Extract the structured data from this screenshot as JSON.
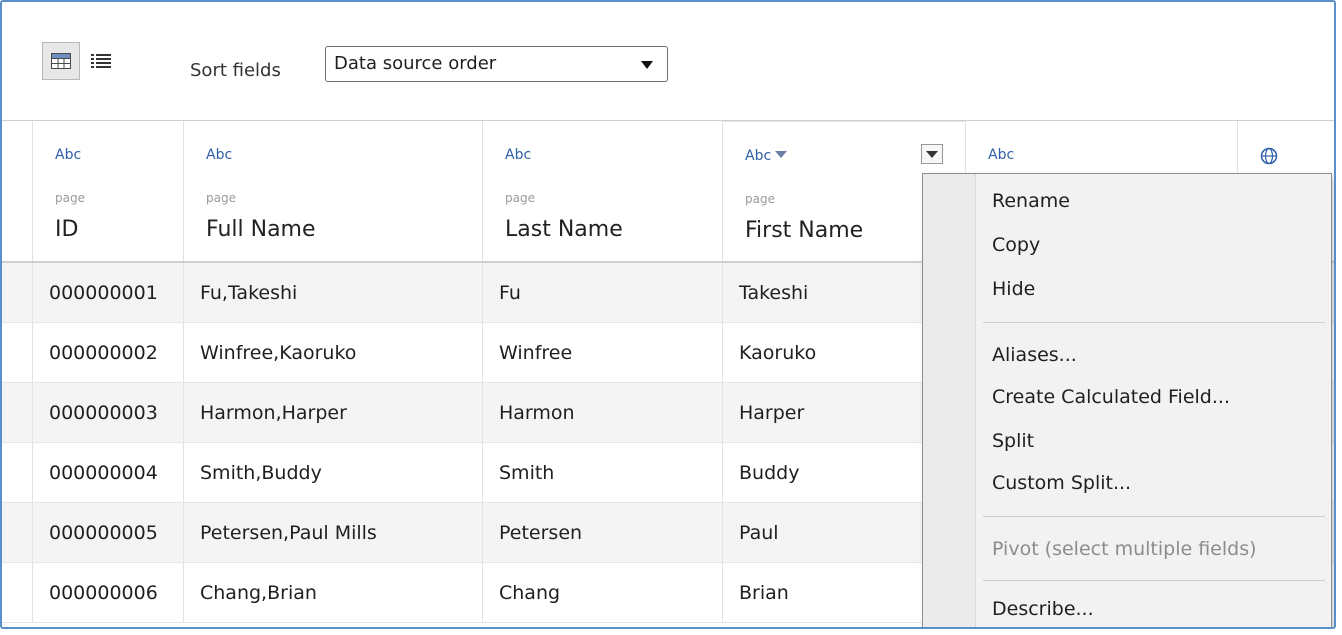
{
  "toolbar": {
    "sort_label": "Sort fields",
    "sort_value": "Data source order",
    "grid_view_icon": "grid-icon",
    "list_view_icon": "list-icon"
  },
  "columns": [
    {
      "type": "Abc",
      "source": "page",
      "name": "ID"
    },
    {
      "type": "Abc",
      "source": "page",
      "name": "Full Name"
    },
    {
      "type": "Abc",
      "source": "page",
      "name": "Last Name"
    },
    {
      "type": "Abc",
      "source": "page",
      "name": "First Name"
    },
    {
      "type": "Abc",
      "source": "",
      "name": ""
    },
    {
      "type": "globe-icon",
      "source": "",
      "name": ""
    }
  ],
  "rows": [
    [
      "000000001",
      "Fu,Takeshi",
      "Fu",
      "Takeshi"
    ],
    [
      "000000002",
      "Winfree,Kaoruko",
      "Winfree",
      "Kaoruko"
    ],
    [
      "000000003",
      "Harmon,Harper",
      "Harmon",
      "Harper"
    ],
    [
      "000000004",
      "Smith,Buddy",
      "Smith",
      "Buddy"
    ],
    [
      "000000005",
      "Petersen,Paul Mills",
      "Petersen",
      "Paul"
    ],
    [
      "000000006",
      "Chang,Brian",
      "Chang",
      "Brian"
    ]
  ],
  "context_menu": {
    "items": [
      {
        "label": "Rename",
        "disabled": false
      },
      {
        "label": "Copy",
        "disabled": false
      },
      {
        "label": "Hide",
        "disabled": false
      },
      {
        "label": "Aliases...",
        "disabled": false
      },
      {
        "label": "Create Calculated Field...",
        "disabled": false
      },
      {
        "label": "Split",
        "disabled": false
      },
      {
        "label": "Custom Split...",
        "disabled": false
      },
      {
        "label": "Pivot (select multiple fields)",
        "disabled": true
      },
      {
        "label": "Describe...",
        "disabled": false
      }
    ]
  },
  "colors": {
    "frame_border": "#5b8fc7",
    "type_label": "#2f5fa8",
    "alt_row": "#f4f4f4",
    "menu_bg": "#f2f2f2"
  }
}
